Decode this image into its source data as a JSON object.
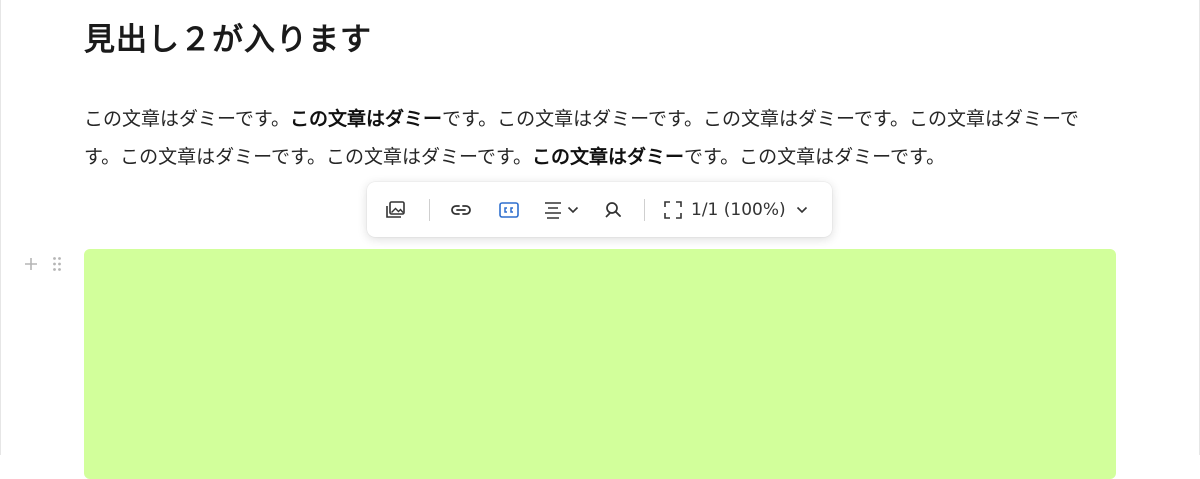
{
  "heading": "見出し２が入ります",
  "paragraph": {
    "segments": [
      {
        "text": "この文章はダミーです。",
        "bold": false
      },
      {
        "text": "この文章はダミー",
        "bold": true
      },
      {
        "text": "です。この文章はダミーです。この文章はダミーです。この文章はダミーです。この文章はダミーです。この文章はダミーです。",
        "bold": false
      },
      {
        "text": "この文章はダミー",
        "bold": true
      },
      {
        "text": "です。この文章はダミーです。",
        "bold": false
      }
    ]
  },
  "toolbar": {
    "zoom_label": "1/1 (100%)",
    "icons": [
      "image-gallery-icon",
      "link-icon",
      "caption-icon",
      "align-center-icon",
      "chevron-down-icon",
      "alt-text-icon",
      "fullscreen-icon",
      "chevron-down-icon"
    ],
    "active_color": "#2f6fce"
  },
  "image_block": {
    "color": "#d2ff9b"
  },
  "block_handles": {
    "icons": [
      "plus-icon",
      "drag-handle-icon"
    ]
  }
}
